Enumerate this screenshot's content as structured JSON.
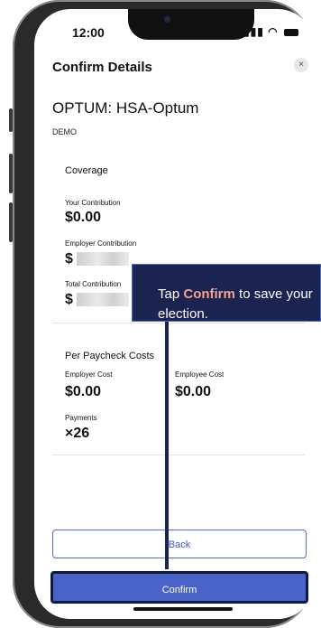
{
  "status_bar": {
    "time": "12:00",
    "signal_wifi": "…∥ ◉"
  },
  "header": {
    "title": "Confirm Details",
    "close_icon": "×"
  },
  "plan": {
    "name": "OPTUM: HSA-Optum",
    "subtitle": "DEMO"
  },
  "coverage": {
    "section_title": "Coverage",
    "your_contribution_label": "Your Contribution",
    "your_contribution_value": "$0.00",
    "employer_contribution_label": "Employer Contribution",
    "employer_contribution_prefix": "$",
    "total_contribution_label": "Total Contribution",
    "total_contribution_prefix": "$"
  },
  "paycheck": {
    "section_title": "Per Paycheck Costs",
    "employer_cost_label": "Employer Cost",
    "employer_cost_value": "$0.00",
    "employee_cost_label": "Employee Cost",
    "employee_cost_value": "$0.00",
    "payments_label": "Payments",
    "payments_value": "×26"
  },
  "buttons": {
    "back_label": "Back",
    "confirm_label": "Confirm"
  },
  "callout": {
    "pre": "Tap ",
    "emphasis": "Confirm",
    "post": " to save your election."
  },
  "colors": {
    "accent": "#4a63c9",
    "callout_bg": "#1b2450",
    "callout_highlight": "#f2a18f"
  }
}
